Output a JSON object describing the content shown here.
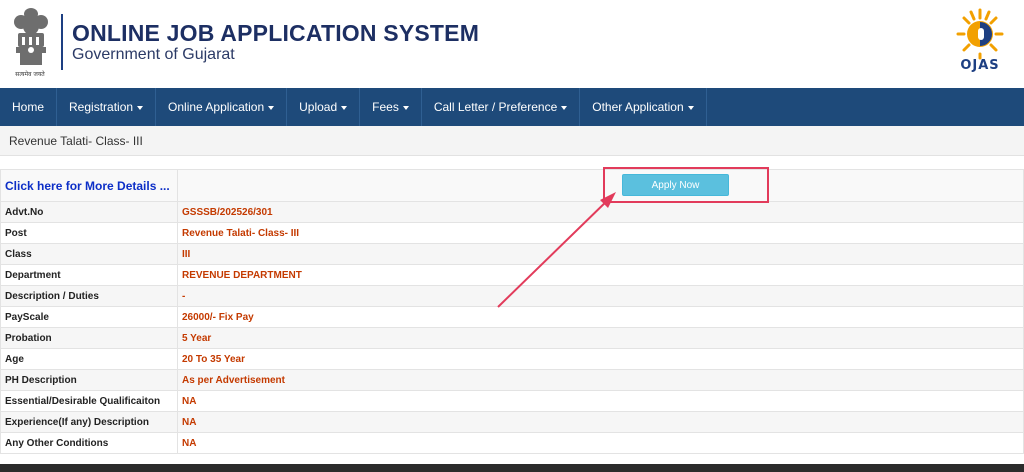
{
  "header": {
    "title": "ONLINE JOB APPLICATION SYSTEM",
    "subtitle": "Government of Gujarat",
    "emblem_motto": "सत्यमेव जयते",
    "logo_text": "OJAS"
  },
  "nav": {
    "items": [
      {
        "label": "Home",
        "dropdown": false
      },
      {
        "label": "Registration",
        "dropdown": true
      },
      {
        "label": "Online Application",
        "dropdown": true
      },
      {
        "label": "Upload",
        "dropdown": true
      },
      {
        "label": "Fees",
        "dropdown": true
      },
      {
        "label": "Call Letter / Preference",
        "dropdown": true
      },
      {
        "label": "Other Application",
        "dropdown": true
      }
    ]
  },
  "page_heading": "Revenue Talati- Class- III",
  "details": {
    "more_link": "Click here for More Details ...",
    "apply_button": "Apply Now",
    "rows": [
      {
        "label": "Advt.No",
        "value": "GSSSB/202526/301"
      },
      {
        "label": "Post",
        "value": "Revenue Talati- Class- III"
      },
      {
        "label": "Class",
        "value": "III"
      },
      {
        "label": "Department",
        "value": "REVENUE DEPARTMENT"
      },
      {
        "label": "Description / Duties",
        "value": "-"
      },
      {
        "label": "PayScale",
        "value": "26000/- Fix Pay"
      },
      {
        "label": "Probation",
        "value": "5 Year"
      },
      {
        "label": "Age",
        "value": "20 To 35 Year"
      },
      {
        "label": "PH Description",
        "value": "As per Advertisement"
      },
      {
        "label": "Essential/Desirable Qualificaiton",
        "value": "NA"
      },
      {
        "label": "Experience(If any) Description",
        "value": "NA"
      },
      {
        "label": "Any Other Conditions",
        "value": "NA"
      }
    ]
  },
  "colors": {
    "nav_bg": "#1e4a7a",
    "title": "#1d2f63",
    "value_text": "#c43a00",
    "link": "#0d2fc7",
    "apply_button": "#5bc0de",
    "annotation": "#e23b5b"
  }
}
